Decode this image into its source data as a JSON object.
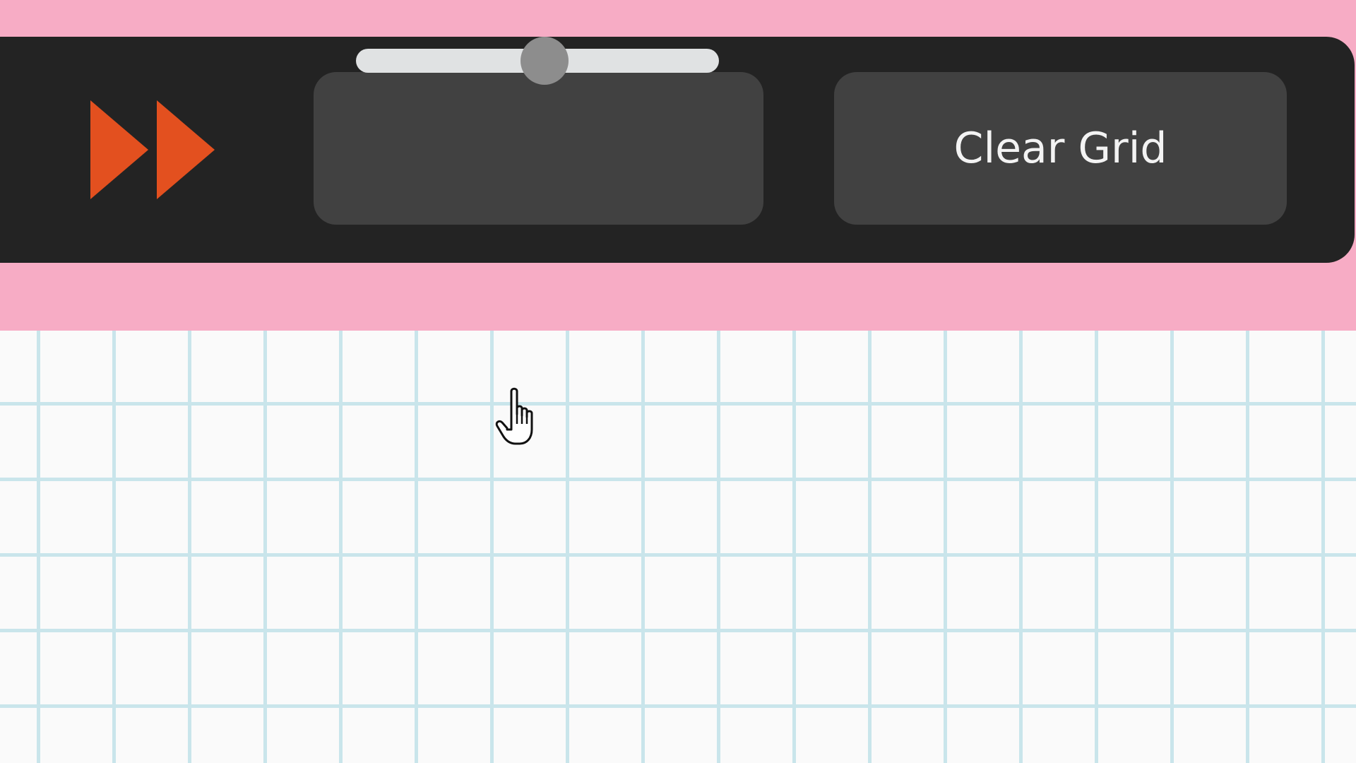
{
  "toolbar": {
    "play_icon": "fast-forward-icon",
    "play_color": "#e3501f",
    "background_color": "#232323",
    "speed_slider": {
      "value": 0.52,
      "track_color": "#e0e2e3",
      "thumb_color": "#8d8d8d"
    },
    "clear_label": "Clear Grid"
  },
  "page": {
    "background_color": "#f7acc5"
  },
  "grid": {
    "background_color": "#fafafa",
    "line_color": "#c9e5eb"
  },
  "cursor": {
    "icon": "hand-pointer-icon"
  }
}
